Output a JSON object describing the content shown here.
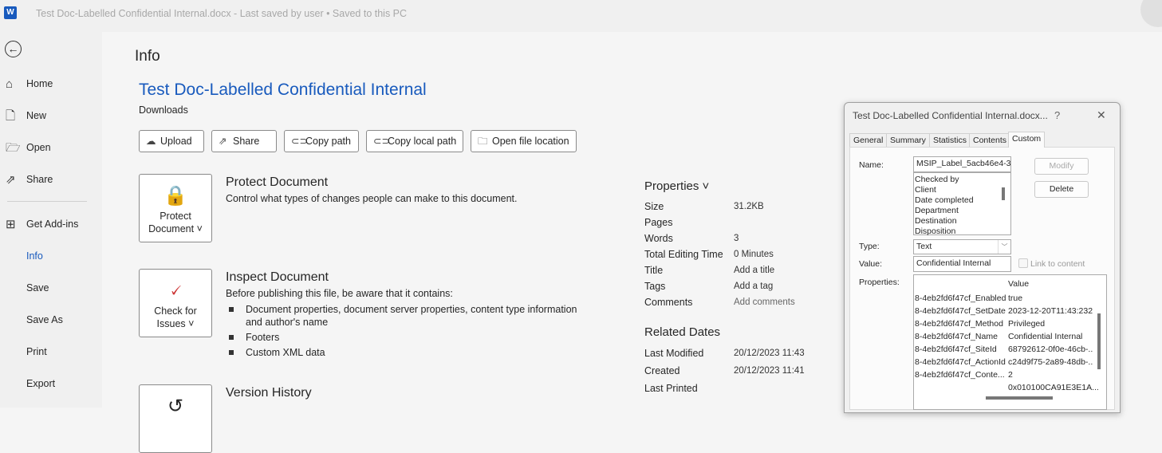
{
  "window": {
    "app_icon": "word-icon",
    "title": "Test Doc-Labelled Confidential Internal.docx  -  Last saved by user  •  Saved to this PC"
  },
  "sidebar": {
    "back_icon": "back-arrow-icon",
    "items": [
      {
        "label": "Home",
        "icon": "home-icon"
      },
      {
        "label": "New",
        "icon": "new-document-icon"
      },
      {
        "label": "Open",
        "icon": "folder-open-icon"
      },
      {
        "label": "Share",
        "icon": "share-icon"
      },
      {
        "label": "Get Add-ins",
        "icon": "grid-icon"
      },
      {
        "label": "Info",
        "active": true
      },
      {
        "label": "Save"
      },
      {
        "label": "Save As"
      },
      {
        "label": "Print"
      },
      {
        "label": "Export"
      }
    ]
  },
  "main": {
    "heading": "Info",
    "doc_title": "Test Doc-Labelled Confidential Internal",
    "location": "Downloads",
    "buttons": [
      {
        "label": "Upload",
        "icon": "upload-icon"
      },
      {
        "label": "Share",
        "icon": "share-icon"
      },
      {
        "label": "Copy path",
        "icon": "link-icon"
      },
      {
        "label": "Copy local path",
        "icon": "link-icon"
      },
      {
        "label": "Open file location",
        "icon": "folder-icon"
      }
    ],
    "sections": {
      "protect": {
        "button_line1": "Protect",
        "button_line2": "Document ˅",
        "title": "Protect Document",
        "text": "Control what types of changes people can make to this document."
      },
      "inspect": {
        "button_line1": "Check for",
        "button_line2": "Issues ˅",
        "title": "Inspect Document",
        "text": "Before publishing this file, be aware that it contains:",
        "bullets": [
          "Document properties, document server properties, content type information and author's name",
          "Footers",
          "Custom XML data"
        ]
      },
      "version": {
        "title": "Version History"
      }
    }
  },
  "properties": {
    "heading": "Properties ˅",
    "rows": [
      {
        "label": "Size",
        "value": "31.2KB"
      },
      {
        "label": "Pages",
        "value": ""
      },
      {
        "label": "Words",
        "value": "3"
      },
      {
        "label": "Total Editing Time",
        "value": "0 Minutes"
      },
      {
        "label": "Title",
        "value": "Add a title"
      },
      {
        "label": "Tags",
        "value": "Add a tag"
      },
      {
        "label": "Comments",
        "value": "Add comments"
      }
    ],
    "dates_heading": "Related Dates",
    "dates": [
      {
        "label": "Last Modified",
        "value": "20/12/2023 11:43"
      },
      {
        "label": "Created",
        "value": "20/12/2023 11:41"
      },
      {
        "label": "Last Printed",
        "value": ""
      }
    ]
  },
  "dialog": {
    "title": "Test Doc-Labelled Confidential Internal.docx...",
    "help": "?",
    "close": "✕",
    "tabs": [
      "General",
      "Summary",
      "Statistics",
      "Contents",
      "Custom"
    ],
    "active_tab": "Custom",
    "name_label": "Name:",
    "name_value": "MSIP_Label_5acb46e4-3d",
    "name_list": [
      "Checked by",
      "Client",
      "Date completed",
      "Department",
      "Destination",
      "Disposition"
    ],
    "modify": "Modify",
    "delete": "Delete",
    "type_label": "Type:",
    "type_value": "Text",
    "value_label": "Value:",
    "value_value": "Confidential Internal",
    "link_to_content": "Link to content",
    "properties_label": "Properties:",
    "value_header": "Value",
    "props": [
      {
        "name": "8-4eb2fd6f47cf_Enabled",
        "value": "true"
      },
      {
        "name": "8-4eb2fd6f47cf_SetDate",
        "value": "2023-12-20T11:43:232"
      },
      {
        "name": "8-4eb2fd6f47cf_Method",
        "value": "Privileged"
      },
      {
        "name": "8-4eb2fd6f47cf_Name",
        "value": "Confidential Internal"
      },
      {
        "name": "8-4eb2fd6f47cf_SiteId",
        "value": "68792612-0f0e-46cb-.."
      },
      {
        "name": "8-4eb2fd6f47cf_ActionId",
        "value": "c24d9f75-2a89-48db-.."
      },
      {
        "name": "8-4eb2fd6f47cf_Conte...",
        "value": "2"
      },
      {
        "name": "",
        "value": "0x010100CA91E3E1A..."
      }
    ]
  }
}
